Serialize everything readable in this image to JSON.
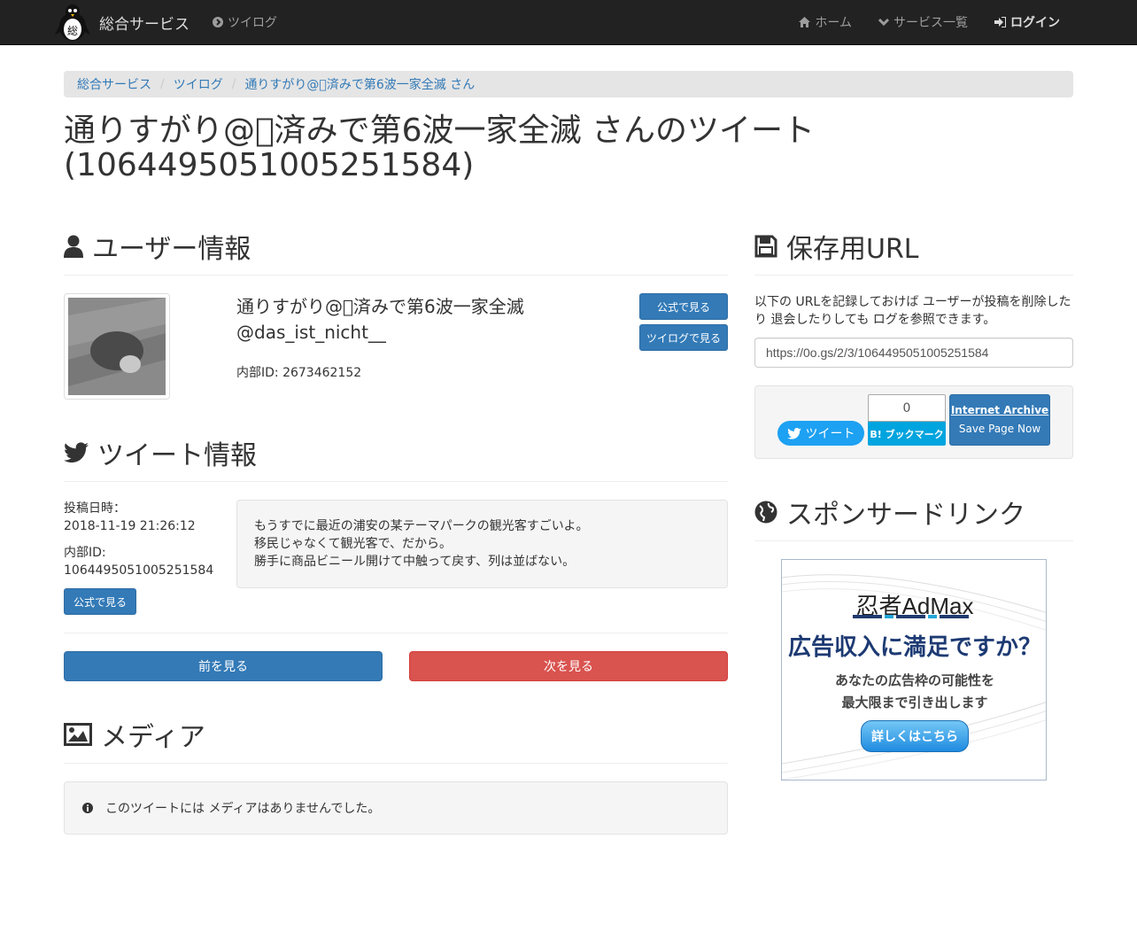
{
  "navbar": {
    "brand": "総合サービス",
    "logo_char": "総",
    "left_items": [
      {
        "label": "ツイログ",
        "icon": "chevron-circle-right-icon"
      }
    ],
    "right_items": [
      {
        "label": "ホーム",
        "icon": "home-icon"
      },
      {
        "label": "サービス一覧",
        "icon": "chevron-down-icon"
      },
      {
        "label": "ログイン",
        "icon": "sign-in-icon"
      }
    ]
  },
  "breadcrumb": [
    "総合サービス",
    "ツイログ",
    "通りすがり@⃣済みで第6波一家全滅 さん"
  ],
  "title": {
    "line1": "通りすがり@⃣済みで第6波一家全滅 さんのツイート",
    "line2": "(1064495051005251584)"
  },
  "user_section": {
    "heading": "ユーザー情報",
    "name": "通りすがり@⃣済みで第6波一家全滅",
    "handle": "@das_ist_nicht__",
    "internal_id": "内部ID: 2673462152",
    "btn_official": "公式で見る",
    "btn_twilog": "ツイログで見る"
  },
  "tweet_section": {
    "heading": "ツイート情報",
    "posted_label": "投稿日時：",
    "posted_value": "2018-11-19 21:26:12",
    "internal_label": "内部ID:",
    "internal_value": "1064495051005251584",
    "btn_official": "公式で見る",
    "body_lines": [
      "もうすでに最近の浦安の某テーマパークの観光客すごいよ。",
      "移民じゃなくて観光客で、だから。",
      "勝手に商品ビニール開けて中触って戻す、列は並ばない。"
    ],
    "prev": "前を見る",
    "next": "次を見る"
  },
  "media_section": {
    "heading": "メディア",
    "empty_message": "このツイートには メディアはありませんでした。"
  },
  "save_section": {
    "heading": "保存用URL",
    "description": "以下の URLを記録しておけば ユーザーが投稿を削除したり 退会したりしても ログを参照できます。",
    "url": "https://0o.gs/2/3/1064495051005251584",
    "tweet_btn": "ツイート",
    "hatena_count": "0",
    "hatena_btn": "B! ブックマーク",
    "ia_title": "Internet Archive",
    "ia_sub": "Save Page Now"
  },
  "sponsor_section": {
    "heading": "スポンサードリンク",
    "ad_brand": "忍者AdMax",
    "ad_head": "広告収入に満足ですか？",
    "ad_sub1": "あなたの広告枠の可能性を",
    "ad_sub2": "最大限まで引き出します",
    "ad_cta": "詳しくはこちら"
  },
  "colors": {
    "navbar": "#222222",
    "primary": "#337ab7",
    "danger": "#d9534f",
    "twitter": "#1da1f2",
    "hatena": "#00a4de"
  }
}
